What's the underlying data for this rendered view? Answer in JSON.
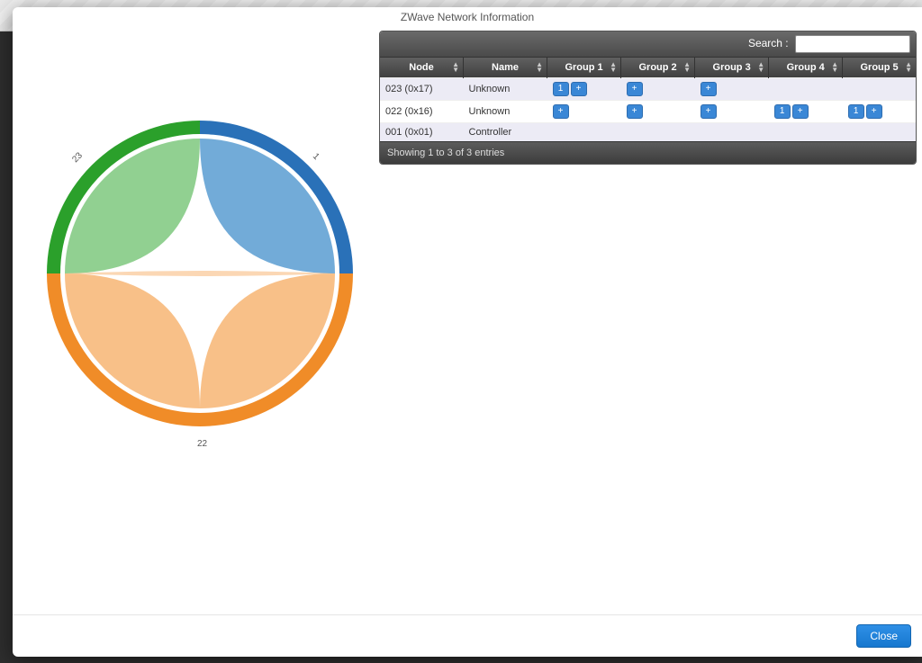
{
  "modal": {
    "title": "ZWave Network Information",
    "close_label": "Close"
  },
  "search": {
    "label": "Search :",
    "value": ""
  },
  "table": {
    "columns": [
      "Node",
      "Name",
      "Group 1",
      "Group 2",
      "Group 3",
      "Group 4",
      "Group 5"
    ],
    "rows": [
      {
        "node": "023 (0x17)",
        "name": "Unknown",
        "groups": [
          {
            "badges": [
              "1"
            ],
            "plus": true
          },
          {
            "badges": [],
            "plus": true
          },
          {
            "badges": [],
            "plus": true
          },
          {
            "badges": [],
            "plus": false
          },
          {
            "badges": [],
            "plus": false
          }
        ]
      },
      {
        "node": "022 (0x16)",
        "name": "Unknown",
        "groups": [
          {
            "badges": [],
            "plus": true
          },
          {
            "badges": [],
            "plus": true
          },
          {
            "badges": [],
            "plus": true
          },
          {
            "badges": [
              "1"
            ],
            "plus": true
          },
          {
            "badges": [
              "1"
            ],
            "plus": true
          }
        ]
      },
      {
        "node": "001 (0x01)",
        "name": "Controller",
        "groups": [
          {
            "badges": [],
            "plus": false
          },
          {
            "badges": [],
            "plus": false
          },
          {
            "badges": [],
            "plus": false
          },
          {
            "badges": [],
            "plus": false
          },
          {
            "badges": [],
            "plus": false
          }
        ]
      }
    ],
    "footer": "Showing 1 to 3 of 3 entries"
  },
  "chart_data": {
    "type": "chord",
    "nodes": [
      {
        "id": "1",
        "label": "1",
        "color_outer": "#2a71b8",
        "color_inner": "#6aa7d6"
      },
      {
        "id": "22",
        "label": "22",
        "color_outer": "#f08c28",
        "color_inner": "#f8bd82"
      },
      {
        "id": "23",
        "label": "23",
        "color_outer": "#2ba02b",
        "color_inner": "#8bcd8b"
      }
    ],
    "links": [
      {
        "source": "1",
        "target": "22"
      },
      {
        "source": "1",
        "target": "23"
      },
      {
        "source": "22",
        "target": "23"
      },
      {
        "source": "22",
        "target": "1"
      }
    ],
    "title": ""
  }
}
